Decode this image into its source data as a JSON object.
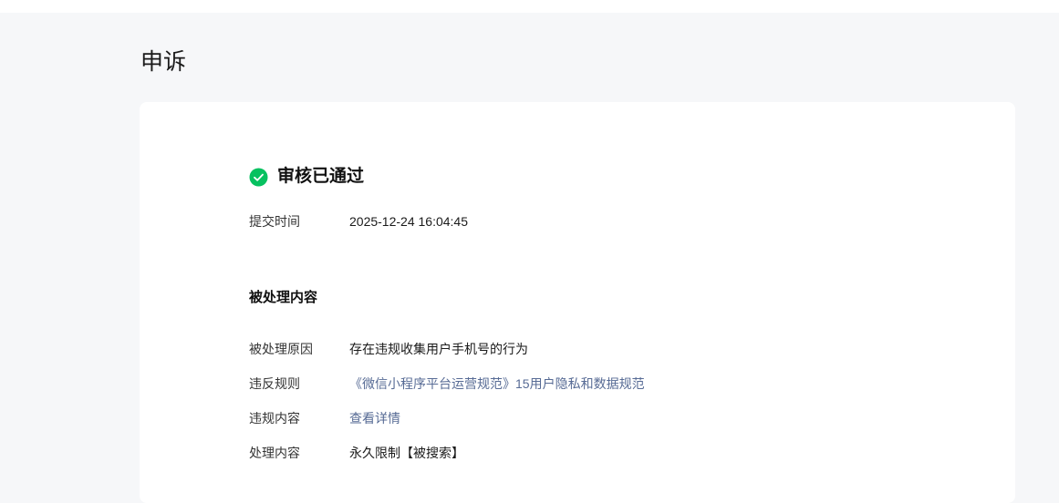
{
  "page": {
    "title": "申诉"
  },
  "status": {
    "icon": "check-circle-icon",
    "color": "#07c160",
    "text": "审核已通过"
  },
  "submit": {
    "label": "提交时间",
    "value": "2025-12-24 16:04:45"
  },
  "section": {
    "title": "被处理内容"
  },
  "details": [
    {
      "label": "被处理原因",
      "value": "存在违规收集用户手机号的行为"
    },
    {
      "label": "违反规则",
      "value": "《微信小程序平台运营规范》15用户隐私和数据规范"
    },
    {
      "label": "违规内容",
      "value": "查看详情"
    },
    {
      "label": "处理内容",
      "value": "永久限制【被搜索】"
    }
  ],
  "link_color": "#576b95"
}
